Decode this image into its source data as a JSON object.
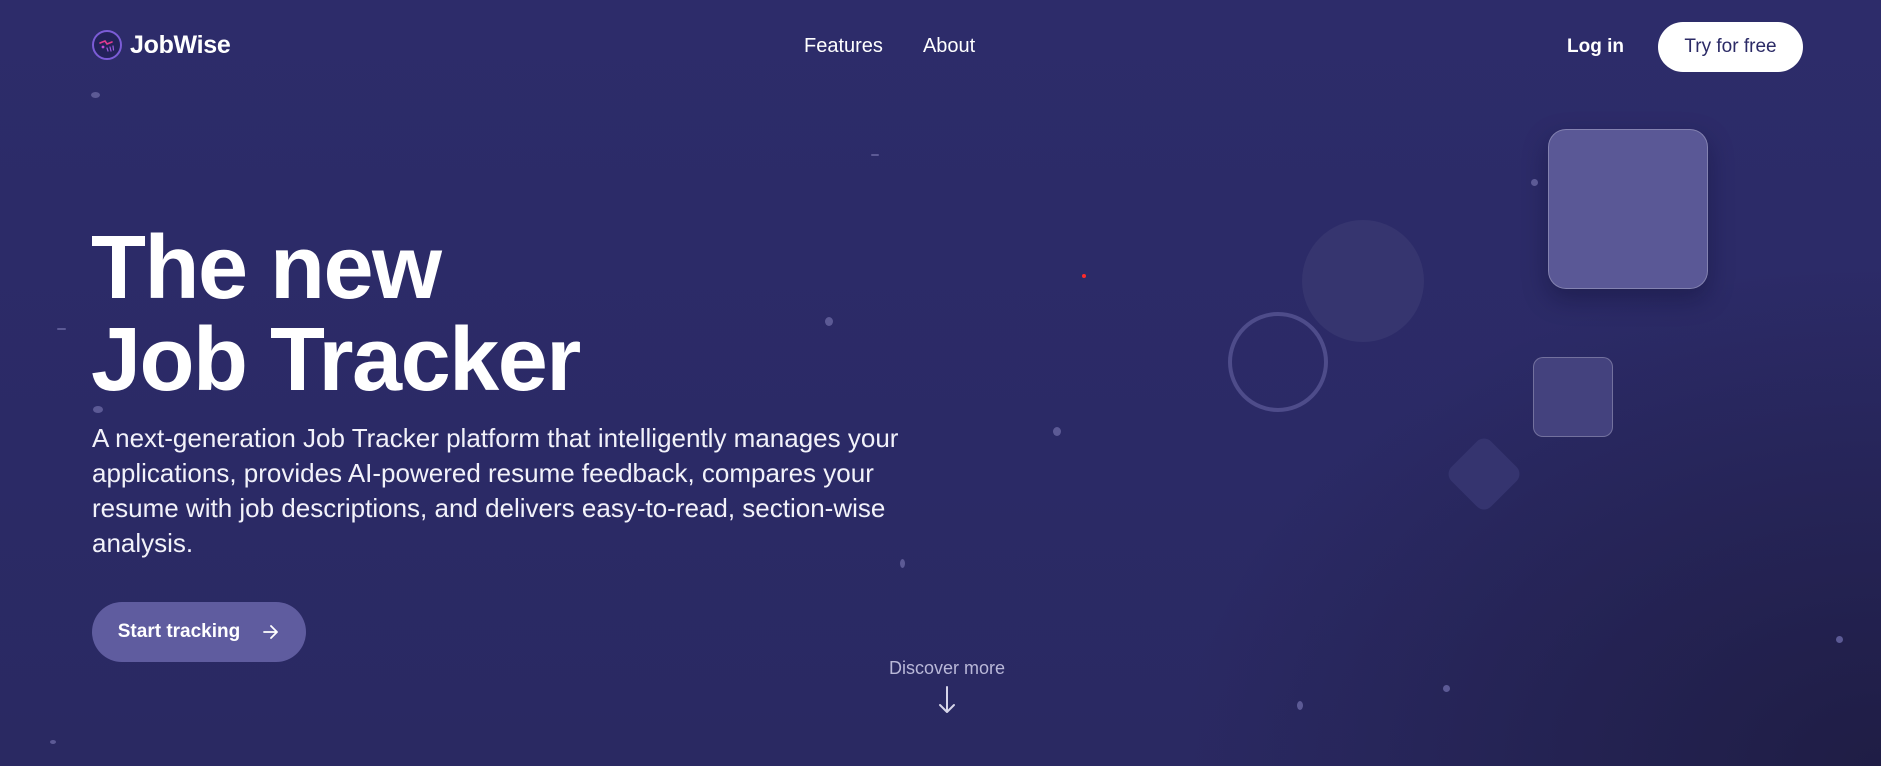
{
  "nav": {
    "brand": "JobWise",
    "links": [
      "Features",
      "About"
    ],
    "login": "Log in",
    "cta": "Try for free"
  },
  "hero": {
    "title_line1": "The new",
    "title_line2": "Job Tracker",
    "description": "A next-generation Job Tracker platform that intelligently manages your applications, provides AI-powered resume feedback, compares your resume with job descriptions, and delivers easy-to-read, section-wise analysis.",
    "cta": "Start tracking"
  },
  "discover": {
    "label": "Discover more"
  },
  "icons": {
    "logo": "jobwise-logo-icon",
    "cta_arrow": "arrow-right-icon",
    "discover_arrow": "arrow-down-icon"
  },
  "colors": {
    "background": "#2b2a66",
    "cta_button": "#5f5c9f",
    "nav_button": "#ffffff",
    "logo_accent": "#7b5cd6"
  }
}
